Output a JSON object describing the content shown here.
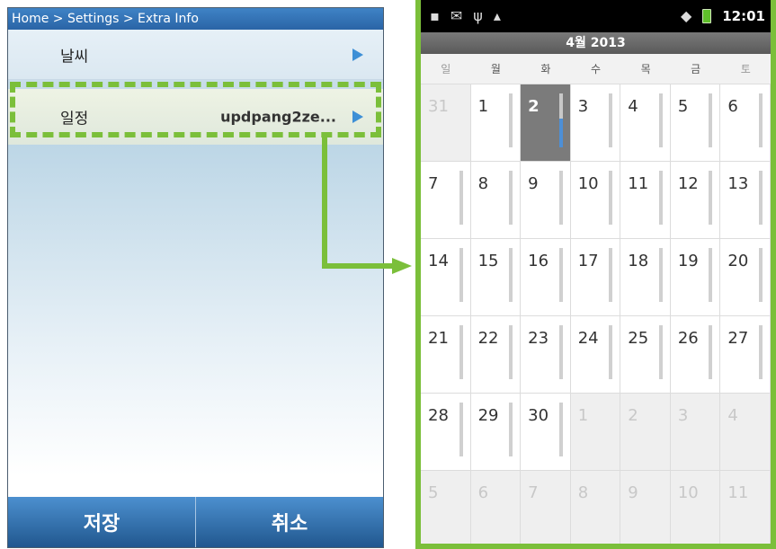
{
  "left": {
    "breadcrumb": "Home > Settings > Extra Info",
    "rows": [
      {
        "label": "날씨",
        "value": ""
      },
      {
        "label": "일정",
        "value": "updpang2ze..."
      }
    ],
    "buttons": {
      "save": "저장",
      "cancel": "취소"
    }
  },
  "calendar": {
    "status_time": "12:01",
    "month_title": "4월 2013",
    "weekdays": [
      "일",
      "월",
      "화",
      "수",
      "목",
      "금",
      "토"
    ],
    "weeks": [
      [
        "31",
        "1",
        "2",
        "3",
        "4",
        "5",
        "6"
      ],
      [
        "7",
        "8",
        "9",
        "10",
        "11",
        "12",
        "13"
      ],
      [
        "14",
        "15",
        "16",
        "17",
        "18",
        "19",
        "20"
      ],
      [
        "21",
        "22",
        "23",
        "24",
        "25",
        "26",
        "27"
      ],
      [
        "28",
        "29",
        "30",
        "1",
        "2",
        "3",
        "4"
      ],
      [
        "5",
        "6",
        "7",
        "8",
        "9",
        "10",
        "11"
      ]
    ],
    "today": "2"
  },
  "colors": {
    "accent_green": "#7bbf3a",
    "header_blue": "#2a64a6",
    "arrow_blue": "#3d8fd6"
  },
  "icons": [
    "sim-card-icon",
    "mail-icon",
    "usb-icon",
    "android-debug-icon",
    "wifi-icon",
    "battery-icon"
  ]
}
